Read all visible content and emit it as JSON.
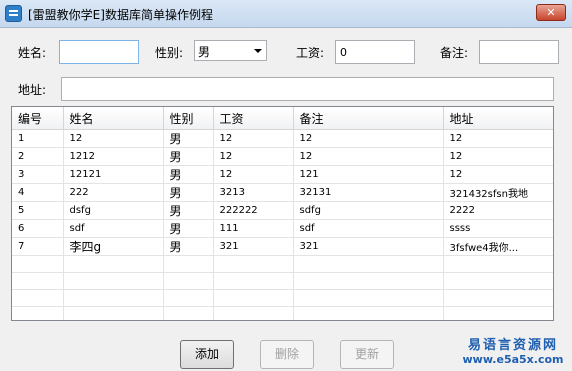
{
  "window": {
    "title": "[雷盟教你学E]数据库简单操作例程",
    "close_label": "✕"
  },
  "form": {
    "name_label": "姓名:",
    "gender_label": "性别:",
    "gender_value": "男",
    "salary_label": "工资:",
    "salary_value": "0",
    "note_label": "备注:",
    "address_label": "地址:",
    "name_value": "",
    "note_value": "",
    "address_value": ""
  },
  "table": {
    "headers": [
      "编号",
      "姓名",
      "性别",
      "工资",
      "备注",
      "地址"
    ],
    "rows": [
      [
        "1",
        "12",
        "男",
        "12",
        "12",
        "12"
      ],
      [
        "2",
        "1212",
        "男",
        "12",
        "12",
        "12"
      ],
      [
        "3",
        "12121",
        "男",
        "12",
        "121",
        "12"
      ],
      [
        "4",
        "222",
        "男",
        "3213",
        "32131",
        "321432sfsn我地"
      ],
      [
        "5",
        "dsfg",
        "男",
        "222222",
        "sdfg",
        "2222"
      ],
      [
        "6",
        "sdf",
        "男",
        "111",
        "sdf",
        "ssss"
      ],
      [
        "7",
        "李四g",
        "男",
        "321",
        "321",
        "3fsfwe4我你..."
      ]
    ]
  },
  "buttons": {
    "add": "添加",
    "delete": "删除",
    "update": "更新"
  },
  "watermark": {
    "line1": "易语言资源网",
    "line2": "www.e5a5x.com"
  }
}
